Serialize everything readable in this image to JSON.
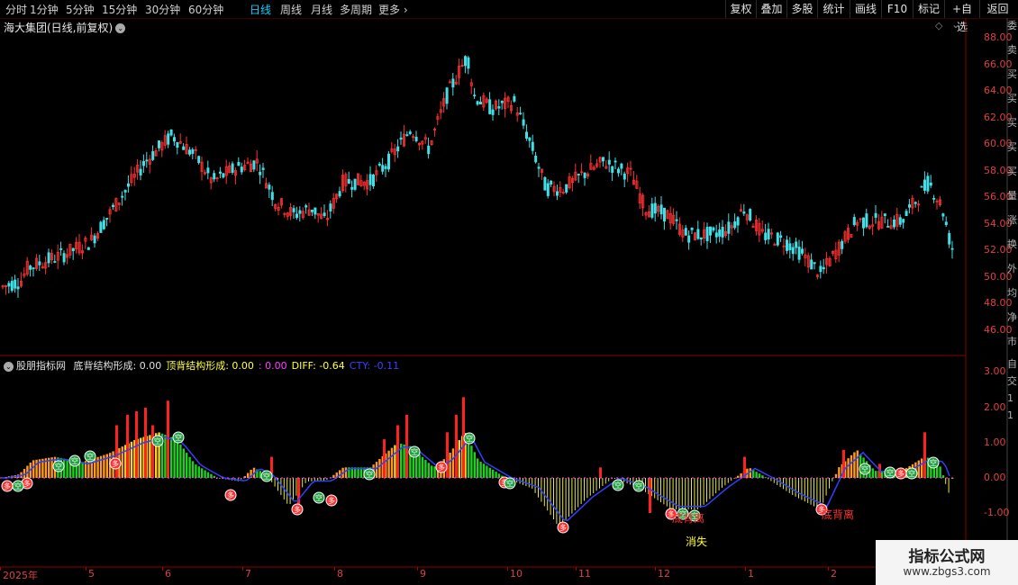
{
  "toolbar": {
    "periods": [
      "分时",
      "1分钟",
      "5分钟",
      "15分钟",
      "30分钟",
      "60分钟",
      "日线",
      "周线",
      "月线",
      "多周期",
      "更多"
    ],
    "active_period": "日线",
    "buttons": [
      "复权",
      "叠加",
      "多股",
      "统计",
      "画线",
      "F10",
      "标记",
      "+自选",
      "返回"
    ]
  },
  "main_chart": {
    "title": "海大集团(日线,前复权)",
    "price_axis": [
      "88.00",
      "66.00",
      "64.00",
      "62.00",
      "60.00",
      "58.00",
      "56.00",
      "54.00",
      "52.00",
      "50.00",
      "48.00",
      "46.00"
    ],
    "up_color": "#ff3030",
    "down_color": "#40e0e8"
  },
  "indicator": {
    "name": "股朋指标网",
    "fields": [
      {
        "label": "底背结构形成:",
        "value": "0.00",
        "color": "#e0e0e0"
      },
      {
        "label": "顶背结构形成:",
        "value": "0.00",
        "color": "#ffff40"
      },
      {
        "label": ":",
        "value": "0.00",
        "color": "#ff40ff"
      },
      {
        "label": "DIFF:",
        "value": "-0.64",
        "color": "#ffff40"
      },
      {
        "label": "CTY:",
        "value": "-0.11",
        "color": "#4040ff"
      }
    ],
    "axis": [
      "3.00",
      "2.00",
      "1.00",
      "0.00",
      "-1.00"
    ],
    "annotations": {
      "bottom_div_1": "底背离",
      "bottom_div_2": "底背离",
      "vanish": "消失",
      "buy": "多",
      "sell": "空"
    }
  },
  "date_axis": [
    "2025年",
    "5",
    "6",
    "7",
    "8",
    "9",
    "10",
    "11",
    "12",
    "1",
    "2"
  ],
  "side_strip_top": [
    "委",
    "卖",
    "买",
    "买",
    "买",
    "买",
    "买",
    "量",
    "涨",
    "换",
    "外",
    "均",
    "净",
    "市"
  ],
  "side_strip_bottom": [
    "自",
    "交",
    "1",
    "1"
  ],
  "watermark": {
    "title": "指标公式网",
    "url": "www.zbgs3.com"
  }
}
